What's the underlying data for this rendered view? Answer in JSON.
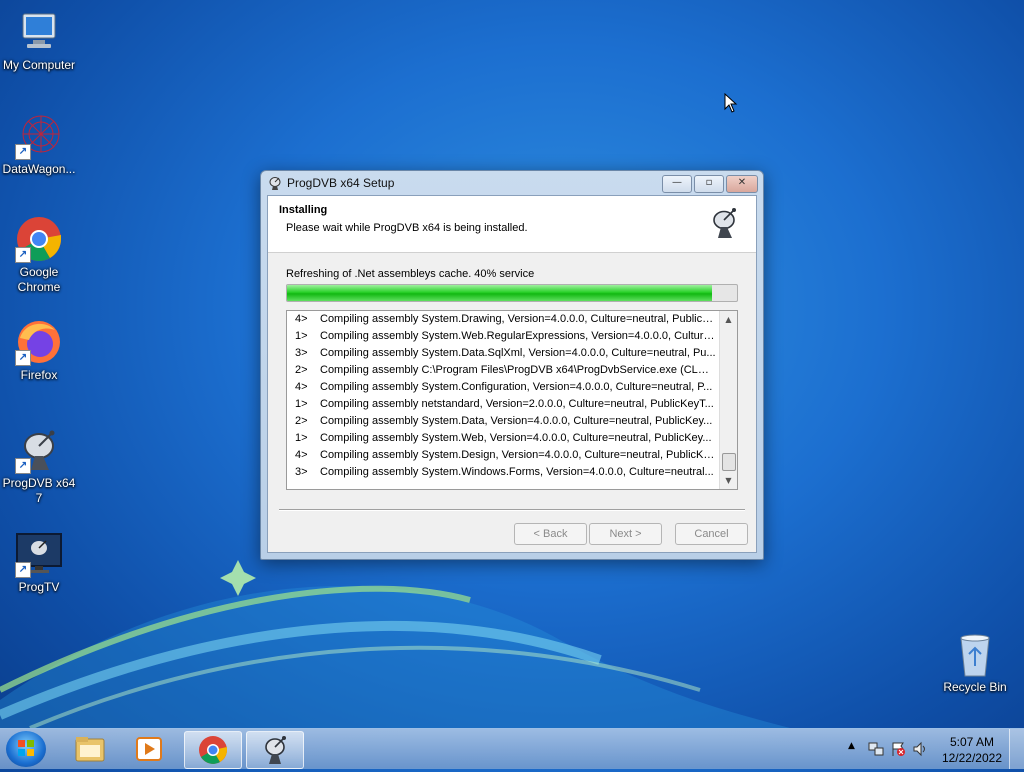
{
  "desktop": {
    "icons": [
      {
        "label": "My Computer",
        "icon": "computer-icon"
      },
      {
        "label": "DataWagon...",
        "icon": "datawagon-icon"
      },
      {
        "label": "Google Chrome",
        "icon": "chrome-icon"
      },
      {
        "label": "Firefox",
        "icon": "firefox-icon"
      },
      {
        "label": "ProgDVB x64 7",
        "icon": "satellite-dish-icon"
      },
      {
        "label": "ProgTV",
        "icon": "tv-icon"
      },
      {
        "label": "Recycle Bin",
        "icon": "recycle-bin-icon"
      }
    ]
  },
  "window": {
    "title": "ProgDVB x64 Setup",
    "header_title": "Installing",
    "header_subtitle": "Please wait while ProgDVB x64 is being installed.",
    "status_text": "Refreshing of .Net assembleys cache. 40% service",
    "progress": 0.945,
    "log": [
      {
        "tid": "4>",
        "msg": "Compiling assembly System.Drawing, Version=4.0.0.0, Culture=neutral, PublicK..."
      },
      {
        "tid": "1>",
        "msg": "Compiling assembly System.Web.RegularExpressions, Version=4.0.0.0, Culture..."
      },
      {
        "tid": "3>",
        "msg": "Compiling assembly System.Data.SqlXml, Version=4.0.0.0, Culture=neutral, Pu..."
      },
      {
        "tid": "2>",
        "msg": "Compiling assembly C:\\Program Files\\ProgDVB x64\\ProgDvbService.exe (CLR v4..."
      },
      {
        "tid": "4>",
        "msg": "Compiling assembly System.Configuration, Version=4.0.0.0, Culture=neutral, P..."
      },
      {
        "tid": "1>",
        "msg": "Compiling assembly netstandard, Version=2.0.0.0, Culture=neutral, PublicKeyT..."
      },
      {
        "tid": "2>",
        "msg": "Compiling assembly System.Data, Version=4.0.0.0, Culture=neutral, PublicKey..."
      },
      {
        "tid": "1>",
        "msg": "Compiling assembly System.Web, Version=4.0.0.0, Culture=neutral, PublicKey..."
      },
      {
        "tid": "4>",
        "msg": "Compiling assembly System.Design, Version=4.0.0.0, Culture=neutral, PublicKe..."
      },
      {
        "tid": "3>",
        "msg": "Compiling assembly System.Windows.Forms, Version=4.0.0.0, Culture=neutral..."
      }
    ],
    "buttons": {
      "back": "< Back",
      "next": "Next >",
      "cancel": "Cancel"
    }
  },
  "taskbar": {
    "items": [
      "explorer-icon",
      "media-player-icon",
      "chrome-icon",
      "progdvb-setup-icon"
    ],
    "active_item": "progdvb-setup-icon",
    "time": "5:07 AM",
    "date": "12/22/2022"
  },
  "colors": {
    "progress_green": "#12b812",
    "desktop_blue": "#1c6fd0"
  }
}
